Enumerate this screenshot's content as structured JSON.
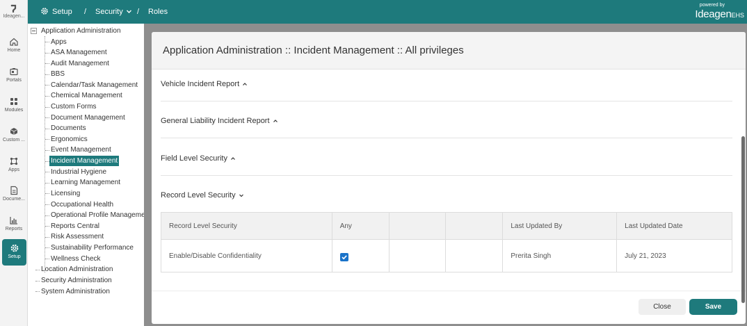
{
  "rail": {
    "logo_label": "Ideagen...",
    "items": [
      {
        "label": "Home",
        "icon": "home-icon"
      },
      {
        "label": "Portals",
        "icon": "portals-icon"
      },
      {
        "label": "Modules",
        "icon": "modules-icon"
      },
      {
        "label": "Custom ...",
        "icon": "custom-icon"
      },
      {
        "label": "Apps",
        "icon": "apps-icon"
      },
      {
        "label": "Docume...",
        "icon": "document-icon"
      },
      {
        "label": "Reports",
        "icon": "reports-icon"
      },
      {
        "label": "Setup",
        "icon": "setup-icon"
      }
    ],
    "active": "Setup"
  },
  "topbar": {
    "setup": "Setup",
    "sep": "/",
    "security": "Security",
    "roles": "Roles",
    "powered_by": "powered by",
    "brand": "Ideagen",
    "brand_suffix": "EHS"
  },
  "tree": {
    "root": "Application Administration",
    "children": [
      "Apps",
      "ASA Management",
      "Audit Management",
      "BBS",
      "Calendar/Task Management",
      "Chemical Management",
      "Custom Forms",
      "Document Management",
      "Documents",
      "Ergonomics",
      "Event Management",
      "Incident Management",
      "Industrial Hygiene",
      "Learning Management",
      "Licensing",
      "Occupational Health",
      "Operational Profile Management",
      "Reports Central",
      "Risk Assessment",
      "Sustainability Performance",
      "Wellness Check"
    ],
    "selected": "Incident Management",
    "others": [
      "Location Administration",
      "Security Administration",
      "System Administration"
    ]
  },
  "panel": {
    "title": "Application Administration :: Incident Management :: All privileges",
    "sections": [
      {
        "label": "Vehicle Incident Report",
        "expanded": false
      },
      {
        "label": "General Liability Incident Report",
        "expanded": false
      },
      {
        "label": "Field Level Security",
        "expanded": false
      },
      {
        "label": "Record Level Security",
        "expanded": true
      }
    ],
    "table": {
      "headers": [
        "Record Level Security",
        "Any",
        "",
        "",
        "Last Updated By",
        "Last Updated Date"
      ],
      "rows": [
        {
          "name": "Enable/Disable Confidentiality",
          "any_checked": true,
          "updated_by": "Prerita Singh",
          "updated_date": "July 21, 2023"
        }
      ]
    },
    "close_label": "Close",
    "save_label": "Save"
  },
  "colors": {
    "brand": "#1e7a7c",
    "checkbox": "#1a73c9"
  }
}
